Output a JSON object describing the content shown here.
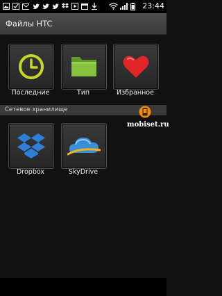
{
  "status_bar": {
    "time": "23:44",
    "left_icons": [
      "photo-icon",
      "checkbox-icon",
      "mail-icon",
      "twitter-icon",
      "twitter-icon",
      "twitter-icon",
      "dropbox-icon",
      "play-icon",
      "calendar-icon",
      "download-icon"
    ],
    "right_icons": [
      "wifi-icon",
      "signal-icon",
      "battery-icon"
    ]
  },
  "header": {
    "title": "Файлы HTC"
  },
  "tiles_top": [
    {
      "label": "Последние",
      "icon": "clock-icon"
    },
    {
      "label": "Тип",
      "icon": "folder-icon"
    },
    {
      "label": "Избранное",
      "icon": "heart-icon"
    }
  ],
  "section": {
    "label": "Сетевое хранилище"
  },
  "tiles_bottom": [
    {
      "label": "Dropbox",
      "icon": "dropbox-icon"
    },
    {
      "label": "SkyDrive",
      "icon": "skydrive-icon"
    }
  ],
  "watermark": {
    "text": "mobiset.ru"
  },
  "colors": {
    "clock": "#c8d62a",
    "folder": "#7fb53a",
    "heart": "#e0262a",
    "dropbox": "#2f7fd8",
    "skydrive": "#3a8fd6"
  }
}
